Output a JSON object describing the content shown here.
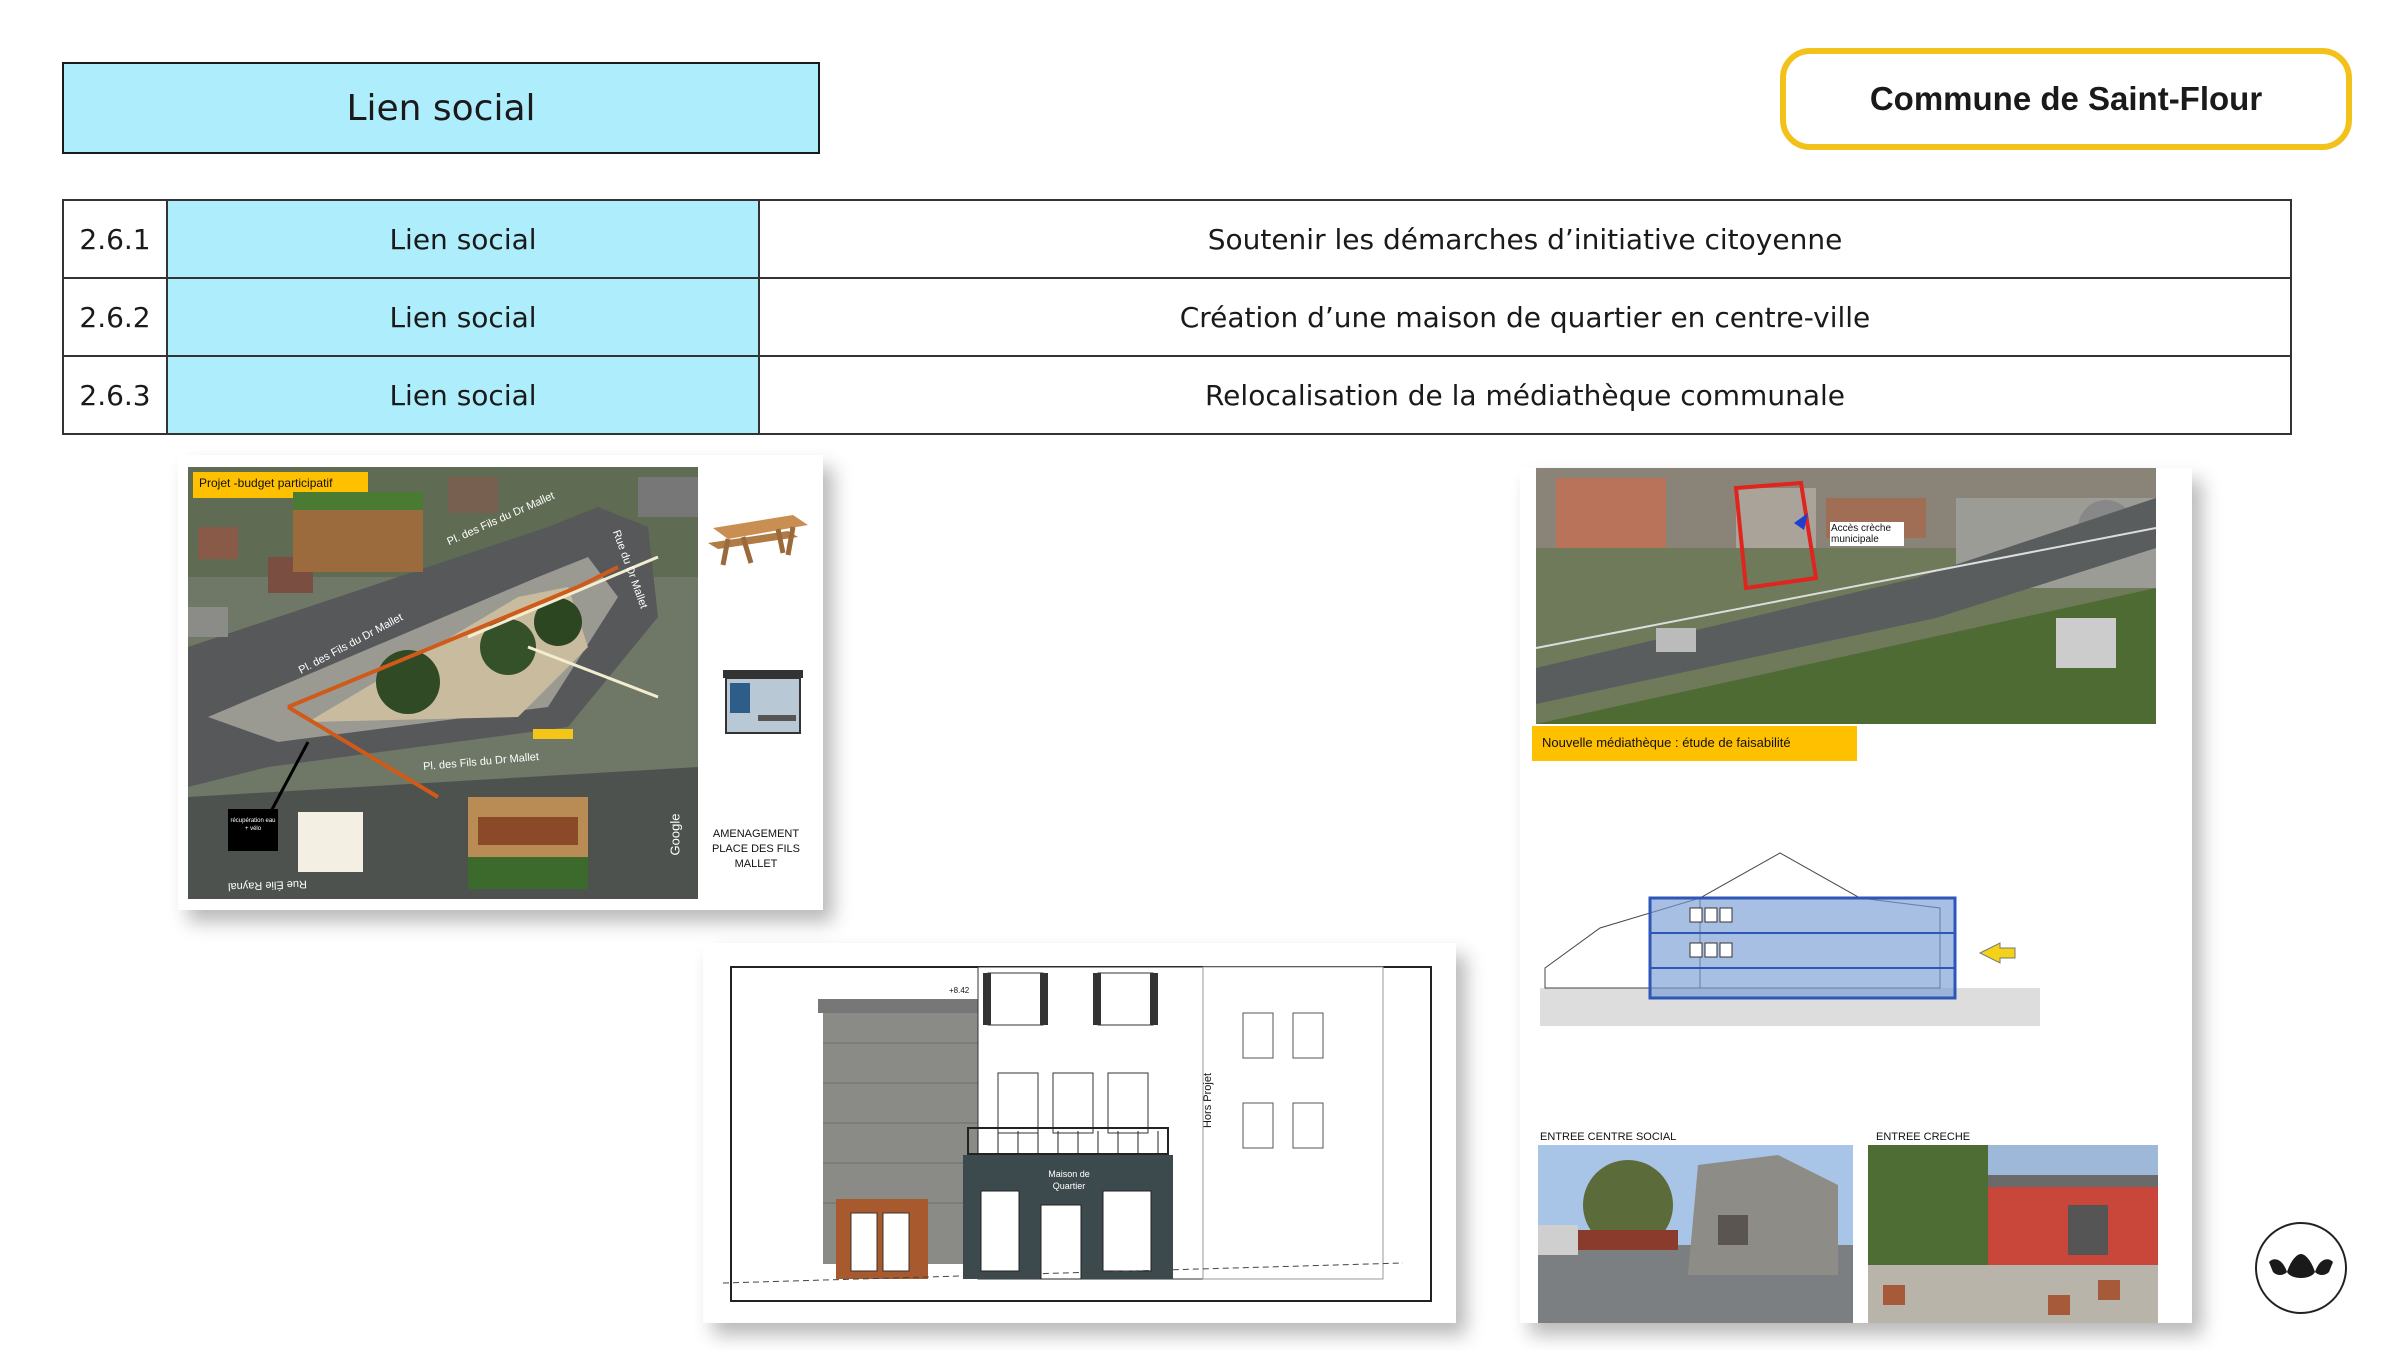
{
  "header": {
    "section_title": "Lien social",
    "commune": "Commune de Saint-Flour"
  },
  "actions": [
    {
      "number": "2.6.1",
      "category": "Lien social",
      "label": "Soutenir les démarches d’initiative citoyenne"
    },
    {
      "number": "2.6.2",
      "category": "Lien social",
      "label": "Création d’une maison de quartier en centre-ville"
    },
    {
      "number": "2.6.3",
      "category": "Lien social",
      "label": "Relocalisation de la médiathèque communale"
    }
  ],
  "card_budget": {
    "tag": "Projet -budget participatif",
    "street_1": "Pl. des Fils du Dr Mallet",
    "street_2": "Pl. des Fils du Dr Mallet",
    "street_3": "Pl. des Fils du Dr Mallet",
    "street_4": "Rue Élie Raynal",
    "street_5": "Rue du Dr Mallet",
    "caption": "AMENAGEMENT PLACE DES FILS MALLET",
    "black_label": "récupération eau + vélo",
    "google": "Google"
  },
  "card_maison": {
    "sign": "Maison de Quartier",
    "side_label": "Hors Projet",
    "level": "+8.42"
  },
  "card_media": {
    "tag": "Nouvelle médiathèque : étude de faisabilité",
    "map_label": "Accès crèche municipale",
    "photo_1_caption": "ENTREE CENTRE SOCIAL",
    "photo_2_caption": "ENTREE CRECHE"
  },
  "colors": {
    "accent_cyan": "#aeeefc",
    "accent_yellow": "#f3c21a",
    "tag_orange": "#ffc000"
  }
}
